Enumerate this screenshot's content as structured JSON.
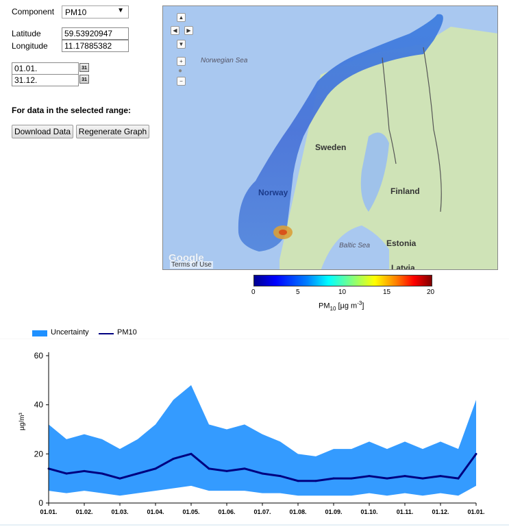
{
  "form": {
    "component_label": "Component",
    "component_value": "PM10",
    "latitude_label": "Latitude",
    "latitude_value": "59.53920947",
    "longitude_label": "Longitude",
    "longitude_value": "11.17885382",
    "date_from": "01.01.",
    "date_to": "31.12.",
    "calendar_glyph": "31",
    "range_note": "For data in the selected range:",
    "download_label": "Download Data",
    "regenerate_label": "Regenerate Graph"
  },
  "map": {
    "labels": {
      "norwegian_sea": "Norwegian Sea",
      "sweden": "Sweden",
      "norway": "Norway",
      "finland": "Finland",
      "baltic_sea": "Baltic Sea",
      "estonia": "Estonia",
      "latvia": "Latvia"
    },
    "attribution_logo": "Google",
    "terms": "Terms of Use"
  },
  "colorbar": {
    "ticks": [
      "0",
      "5",
      "10",
      "15",
      "20"
    ],
    "label_main": "PM",
    "label_sub": "10",
    "label_unit": "[µg m",
    "label_exp": "-3",
    "label_close": "]"
  },
  "chart_data": {
    "type": "area",
    "legend": [
      {
        "name": "Uncertainty",
        "color": "#1e90ff"
      },
      {
        "name": "PM10",
        "color": "#000080"
      }
    ],
    "ylabel": "µg/m³",
    "ylim": [
      0,
      60
    ],
    "yticks": [
      "0",
      "20",
      "40",
      "60"
    ],
    "xticks": [
      "01.01.",
      "01.02.",
      "01.03.",
      "01.04.",
      "01.05.",
      "01.06.",
      "01.07.",
      "01.08.",
      "01.09.",
      "01.10.",
      "01.11.",
      "01.12.",
      "01.01."
    ],
    "series": [
      {
        "name": "PM10",
        "x": [
          "01.01.",
          "15.01.",
          "01.02.",
          "15.02.",
          "01.03.",
          "15.03.",
          "01.04.",
          "15.04.",
          "01.05.",
          "15.05.",
          "01.06.",
          "15.06.",
          "01.07.",
          "15.07.",
          "01.08.",
          "15.08.",
          "01.09.",
          "15.09.",
          "01.10.",
          "15.10.",
          "01.11.",
          "15.11.",
          "01.12.",
          "15.12.",
          "31.12."
        ],
        "values": [
          14,
          12,
          13,
          12,
          10,
          12,
          14,
          18,
          20,
          14,
          13,
          14,
          12,
          11,
          9,
          9,
          10,
          10,
          11,
          10,
          11,
          10,
          11,
          10,
          20
        ]
      },
      {
        "name": "Uncertainty",
        "upper": [
          32,
          26,
          28,
          26,
          22,
          26,
          32,
          42,
          48,
          32,
          30,
          32,
          28,
          25,
          20,
          19,
          22,
          22,
          25,
          22,
          25,
          22,
          25,
          22,
          42
        ],
        "lower": [
          5,
          4,
          5,
          4,
          3,
          4,
          5,
          6,
          7,
          5,
          5,
          5,
          4,
          4,
          3,
          3,
          3,
          3,
          4,
          3,
          4,
          3,
          4,
          3,
          7
        ]
      }
    ]
  }
}
